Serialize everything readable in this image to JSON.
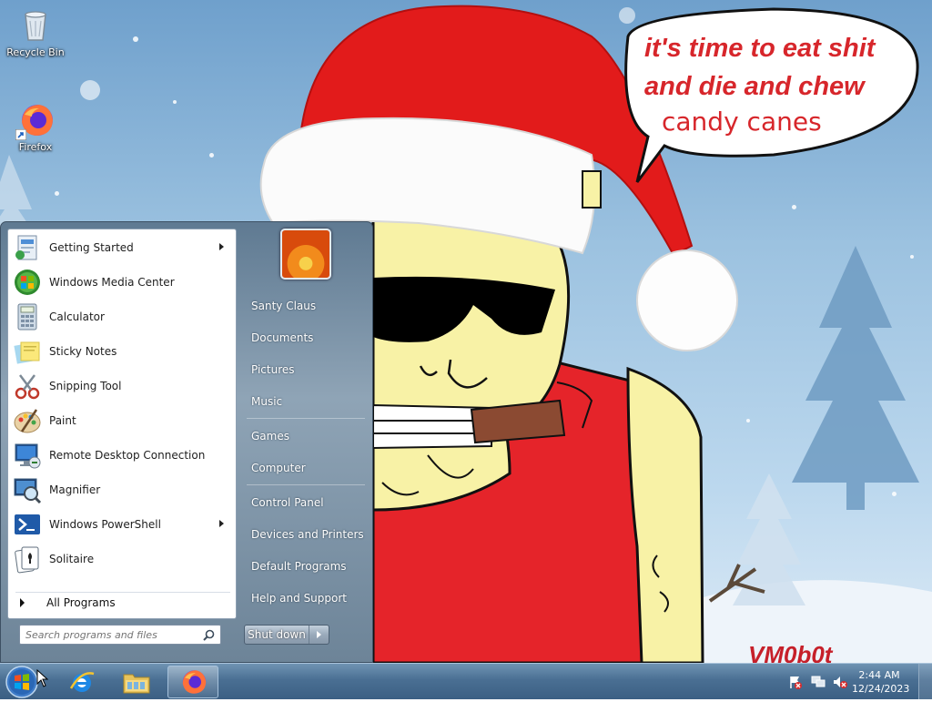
{
  "wallpaper": {
    "speech_line1": "it's time to eat shit",
    "speech_line2": "and die and chew",
    "speech_line3": "candy canes",
    "signature": "VM0b0t"
  },
  "desktop_icons": [
    {
      "label": "Recycle Bin",
      "icon": "recycle-bin-icon"
    },
    {
      "label": "Firefox",
      "icon": "firefox-icon"
    }
  ],
  "start_menu": {
    "programs": [
      {
        "label": "Getting Started",
        "icon": "getting-started-icon",
        "submenu": true
      },
      {
        "label": "Windows Media Center",
        "icon": "media-center-icon",
        "submenu": false
      },
      {
        "label": "Calculator",
        "icon": "calculator-icon",
        "submenu": false
      },
      {
        "label": "Sticky Notes",
        "icon": "sticky-notes-icon",
        "submenu": false
      },
      {
        "label": "Snipping Tool",
        "icon": "snipping-tool-icon",
        "submenu": false
      },
      {
        "label": "Paint",
        "icon": "paint-icon",
        "submenu": false
      },
      {
        "label": "Remote Desktop Connection",
        "icon": "remote-desktop-icon",
        "submenu": false
      },
      {
        "label": "Magnifier",
        "icon": "magnifier-icon",
        "submenu": false
      },
      {
        "label": "Windows PowerShell",
        "icon": "powershell-icon",
        "submenu": true
      },
      {
        "label": "Solitaire",
        "icon": "solitaire-icon",
        "submenu": false
      }
    ],
    "all_programs": "All Programs",
    "search_placeholder": "Search programs and files",
    "right_links": [
      "Santy Claus",
      "Documents",
      "Pictures",
      "Music",
      "Games",
      "Computer",
      "Control Panel",
      "Devices and Printers",
      "Default Programs",
      "Help and Support"
    ],
    "shutdown_label": "Shut down"
  },
  "taskbar": {
    "pinned": [
      "internet-explorer-icon",
      "windows-explorer-icon",
      "firefox-icon"
    ],
    "clock_time": "2:44 AM",
    "clock_date": "12/24/2023"
  },
  "colors": {
    "santa_hat_red": "#e21b1b",
    "shirt_red": "#e5242a",
    "face_yellow": "#f8f2a6",
    "speech_text_red": "#d7262b",
    "taskbar_blue": "#4a6f93"
  }
}
